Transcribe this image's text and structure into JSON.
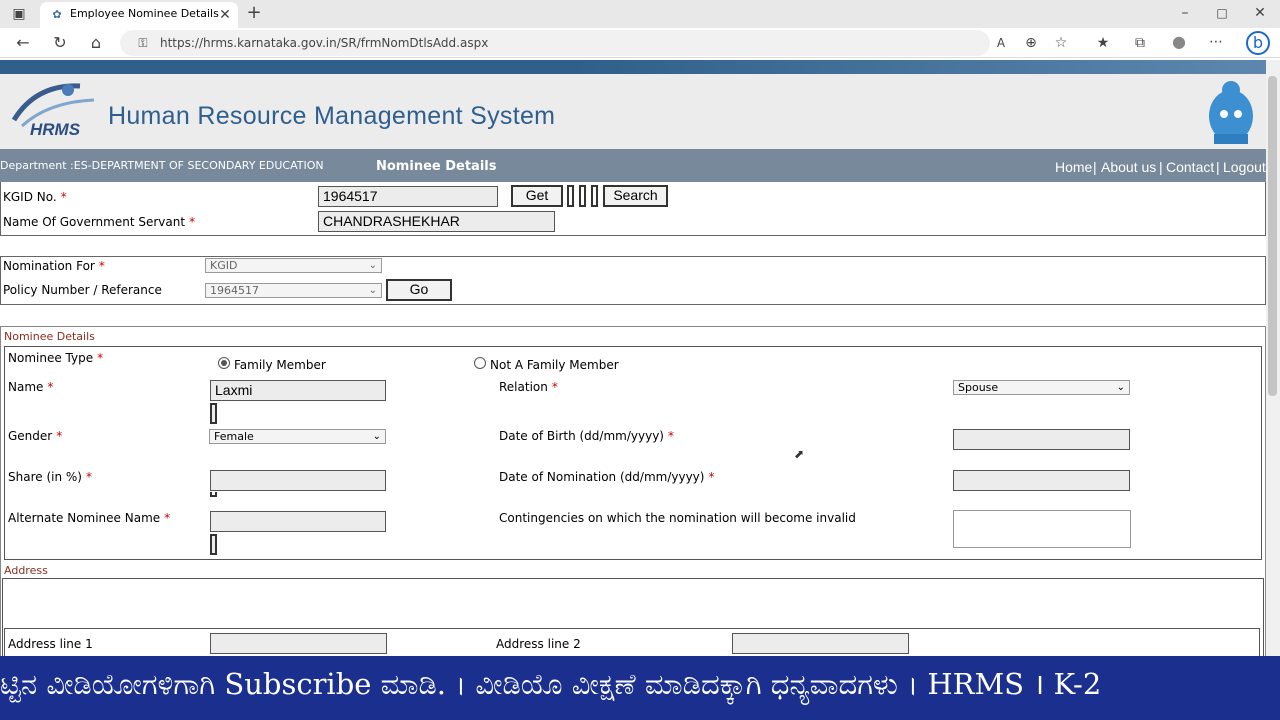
{
  "browser": {
    "tab_title": "Employee Nominee Details",
    "url": "https://hrms.karnataka.gov.in/SR/frmNomDtlsAdd.aspx"
  },
  "header": {
    "logo_text": "HRMS",
    "system_title": "Human Resource Management System"
  },
  "navbar": {
    "department": "Department :ES-DEPARTMENT OF SECONDARY EDUCATION",
    "page_title": "Nominee Details",
    "links": [
      "Home",
      "About us",
      "Contact",
      "Logout"
    ]
  },
  "employee": {
    "kgid_label": "KGID No.",
    "kgid_value": "1964517",
    "get_label": "Get",
    "search_label": "Search",
    "name_label": "Name Of Government Servant",
    "name_value": "CHANDRASHEKHAR"
  },
  "nomination": {
    "for_label": "Nomination For",
    "for_value": "KGID",
    "policy_label": "Policy Number / Referance",
    "policy_value": "1964517",
    "go_label": "Go"
  },
  "nominee": {
    "section_title": "Nominee Details",
    "type_label": "Nominee Type",
    "type_options": [
      "Family Member",
      "Not A Family Member"
    ],
    "type_selected": "Family Member",
    "name_label": "Name",
    "name_value": "Laxmi",
    "relation_label": "Relation",
    "relation_value": "Spouse",
    "gender_label": "Gender",
    "gender_value": "Female",
    "dob_label": "Date of Birth (dd/mm/yyyy)",
    "dob_value": "",
    "share_label": "Share (in %)",
    "share_value": "",
    "nomination_date_label": "Date of Nomination (dd/mm/yyyy)",
    "nomination_date_value": "",
    "alternate_label": "Alternate Nominee Name",
    "alternate_value": "",
    "contingencies_label": "Contingencies on which the nomination will become invalid",
    "contingencies_value": ""
  },
  "address": {
    "section_title": "Address",
    "line1_label": "Address line 1",
    "line1_value": "",
    "line2_label": "Address line 2",
    "line2_value": ""
  },
  "ticker": {
    "text": "ಟ್ಟಿನ ವೀಡಿಯೋಗಳಿಗಾಗಿ Subscribe ಮಾಡಿ. । ವೀಡಿಯೊ ವೀಕ್ಷಣೆ ಮಾಡಿದಕ್ಕಾಗಿ ಧನ್ಯವಾದಗಳು । HRMS । K-2"
  },
  "required_mark": "*",
  "colors": {
    "navbar": "#78899b",
    "ticker": "#1b2f8f",
    "section_title": "#8b2e1f"
  }
}
